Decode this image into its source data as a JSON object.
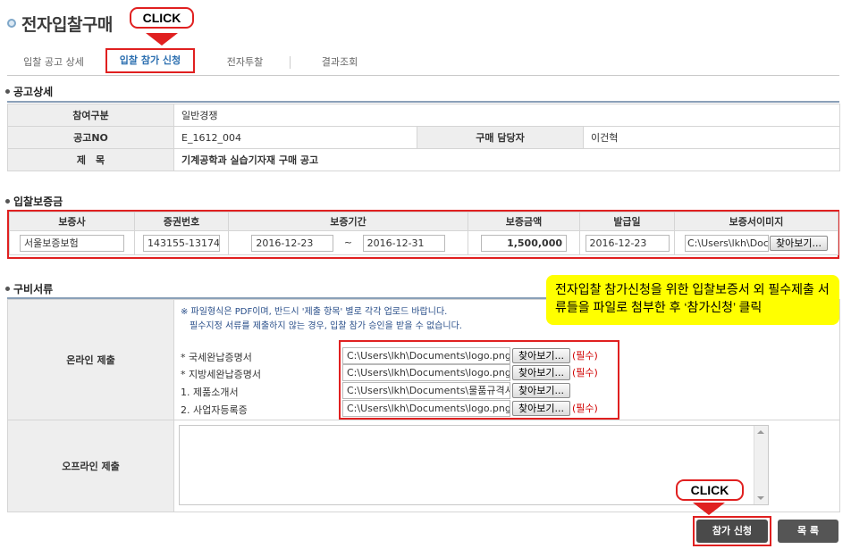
{
  "page": {
    "title": "전자입찰구매"
  },
  "callouts": {
    "tab_click": "CLICK",
    "submit_click": "CLICK",
    "instruction": "전자입찰 참가신청을 위한 입찰보증서 외 필수제출 서류들을 파일로 첨부한 후 ‘참가신청’ 클릭"
  },
  "tabs": [
    {
      "label": "입찰 공고 상세"
    },
    {
      "label": "입찰 참가 신청"
    },
    {
      "label": "전자투찰"
    },
    {
      "label": "결과조회"
    }
  ],
  "notice_section": {
    "heading": "공고상세",
    "rows": {
      "participation_label": "참여구분",
      "participation_value": "일반경쟁",
      "notice_no_label": "공고NO",
      "notice_no_value": "E_1612_004",
      "manager_label": "구매 담당자",
      "manager_value": "이건혁",
      "subject_label": "제　목",
      "subject_value": "기계공학과 실습기자재 구매 공고"
    }
  },
  "guarantee_section": {
    "heading": "입찰보증금",
    "columns": [
      "보증사",
      "증권번호",
      "보증기간",
      "보증금액",
      "발급일",
      "보증서이미지"
    ],
    "row": {
      "guarantor": "서울보증보험",
      "policy_no": "143155-13174",
      "period_start": "2016-12-23",
      "period_sep": "~",
      "period_end": "2016-12-31",
      "amount": "1,500,000",
      "issue_date": "2016-12-23",
      "image_path": "C:\\Users\\lkh\\Docu",
      "browse_label": "찾아보기..."
    }
  },
  "documents_section": {
    "heading": "구비서류",
    "online_label": "온라인 제출",
    "offline_label": "오프라인 제출",
    "notice_line1": "※ 파일형식은 PDF이며, 반드시 '제출 항목' 별로 각각 업로드 바랍니다.",
    "notice_line2": "필수지정 서류를 제출하지 않는 경우, 입찰 참가 승인을 받을 수 없습니다.",
    "browse_label": "찾아보기...",
    "required_mark": "(필수)",
    "items": [
      {
        "label": "* 국세완납증명서",
        "path": "C:\\Users\\lkh\\Documents\\logo.png"
      },
      {
        "label": "* 지방세완납증명서",
        "path": "C:\\Users\\lkh\\Documents\\logo.png"
      },
      {
        "label": "1. 제품소개서",
        "path": "C:\\Users\\lkh\\Documents\\물품규격서"
      },
      {
        "label": "2. 사업자등록증",
        "path": "C:\\Users\\lkh\\Documents\\logo.png"
      }
    ]
  },
  "buttons": {
    "apply": "참가 신청",
    "list": "목 록"
  },
  "colors": {
    "highlight_red": "#e02020",
    "callout_yellow": "#ffff00",
    "button_dark": "#4a4a4a",
    "active_tab_text": "#2c6fb0"
  }
}
